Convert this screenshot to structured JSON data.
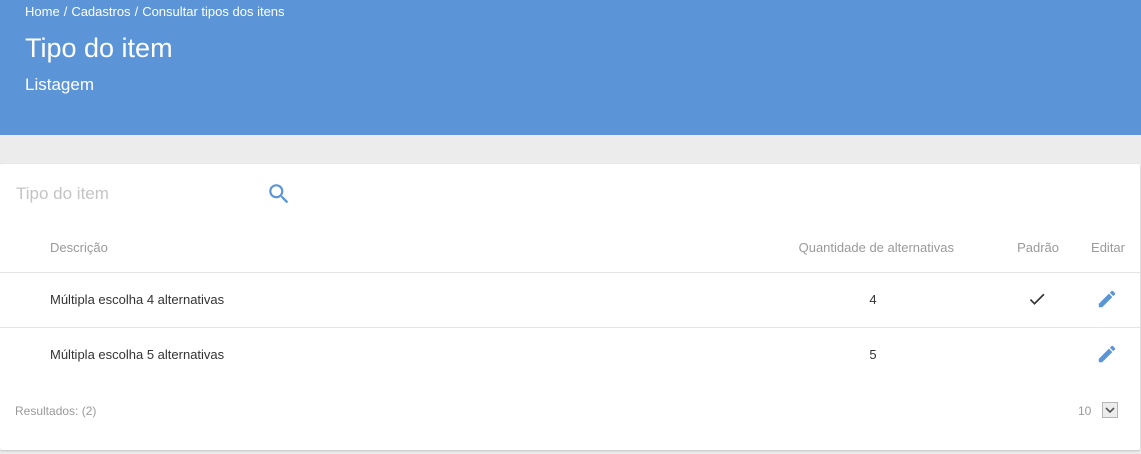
{
  "breadcrumb": {
    "items": [
      "Home",
      "Cadastros",
      "Consultar tipos dos itens"
    ],
    "separator": "/"
  },
  "header": {
    "title": "Tipo do item",
    "subtitle": "Listagem",
    "color": "#5b94d7"
  },
  "search": {
    "placeholder": "Tipo do item",
    "value": "",
    "icon": "search-icon"
  },
  "table": {
    "columns": {
      "descricao": "Descrição",
      "quantidade": "Quantidade de alternativas",
      "padrao": "Padrão",
      "editar": "Editar"
    },
    "rows": [
      {
        "descricao": "Múltipla escolha 4 alternativas",
        "quantidade": "4",
        "padrao": true
      },
      {
        "descricao": "Múltipla escolha 5 alternativas",
        "quantidade": "5",
        "padrao": false
      }
    ]
  },
  "footer": {
    "results": "Resultados: (2)",
    "page_size": "10"
  },
  "colors": {
    "accent": "#5b94d7",
    "edit_icon": "#5b94d7"
  }
}
